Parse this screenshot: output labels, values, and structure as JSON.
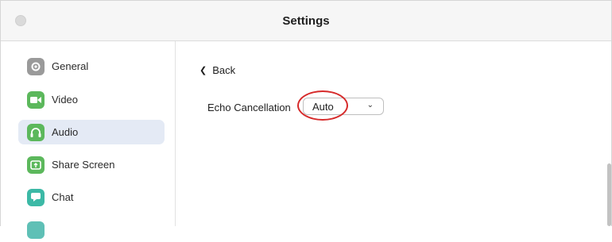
{
  "window": {
    "title": "Settings"
  },
  "sidebar": {
    "items": [
      {
        "label": "General",
        "icon": "gear-icon",
        "color": "#9a9a9a",
        "active": false
      },
      {
        "label": "Video",
        "icon": "video-camera-icon",
        "color": "#5cb85c",
        "active": false
      },
      {
        "label": "Audio",
        "icon": "headphones-icon",
        "color": "#5cb85c",
        "active": true
      },
      {
        "label": "Share Screen",
        "icon": "share-screen-icon",
        "color": "#5cb85c",
        "active": false
      },
      {
        "label": "Chat",
        "icon": "chat-bubble-icon",
        "color": "#3cb9a6",
        "active": false
      },
      {
        "label": "",
        "icon": "partial-icon",
        "color": "#5fc0b6",
        "active": false
      }
    ]
  },
  "main": {
    "back_label": "Back",
    "echo": {
      "label": "Echo Cancellation",
      "value": "Auto"
    }
  },
  "colors": {
    "active_bg": "#e4eaf5",
    "annotation": "#d62a2a"
  }
}
